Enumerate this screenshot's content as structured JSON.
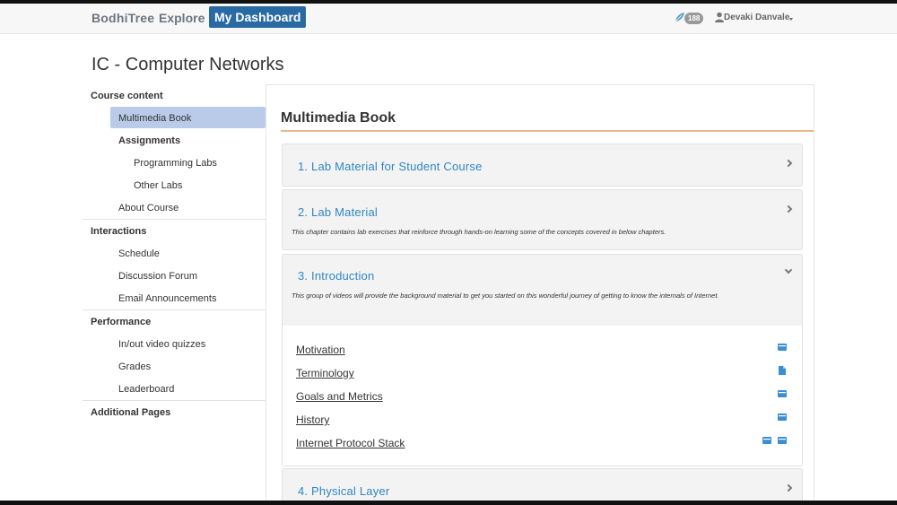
{
  "navbar": {
    "brand": "BodhiTree",
    "explore": "Explore",
    "dashboard": "My Dashboard",
    "badge_count": "188",
    "user_name": "Devaki Danvale"
  },
  "page": {
    "title": "IC - Computer Networks"
  },
  "sidebar": {
    "sections": [
      {
        "label": "Course content"
      },
      {
        "label": "Interactions"
      },
      {
        "label": "Performance"
      },
      {
        "label": "Additional Pages"
      }
    ],
    "items": [
      {
        "label": "Multimedia Book"
      },
      {
        "label": "Assignments"
      },
      {
        "label": "Programming Labs"
      },
      {
        "label": "Other Labs"
      },
      {
        "label": "About Course"
      },
      {
        "label": "Schedule"
      },
      {
        "label": "Discussion Forum"
      },
      {
        "label": "Email Announcements"
      },
      {
        "label": "In/out video quizzes"
      },
      {
        "label": "Grades"
      },
      {
        "label": "Leaderboard"
      }
    ]
  },
  "main": {
    "title": "Multimedia Book",
    "chapters": [
      {
        "title": "1. Lab Material for Student Course",
        "description": ""
      },
      {
        "title": "2. Lab Material",
        "description": "This chapter contains lab exercises that reinforce through hands-on learning some of the concepts covered in below chapters."
      },
      {
        "title": "3. Introduction",
        "description": "This group of videos will provide the background material to get you started on this wonderful journey of getting to know the internals of Internet."
      },
      {
        "title": "4. Physical Layer",
        "description": ""
      }
    ],
    "lessons": [
      {
        "label": "Motivation",
        "icons": [
          "video-icon"
        ]
      },
      {
        "label": "Terminology",
        "icons": [
          "document-icon"
        ]
      },
      {
        "label": "Goals and Metrics",
        "icons": [
          "video-icon"
        ]
      },
      {
        "label": "History",
        "icons": [
          "video-icon"
        ]
      },
      {
        "label": "Internet Protocol Stack",
        "icons": [
          "video-icon",
          "video-icon"
        ]
      }
    ]
  },
  "colors": {
    "dashboard_button": "#2a6aa3",
    "link_blue": "#2f86c4",
    "active_sidebar": "#b9cbe8",
    "title_rule": "#e9b98e",
    "icon_blue": "#3d8ed0"
  }
}
